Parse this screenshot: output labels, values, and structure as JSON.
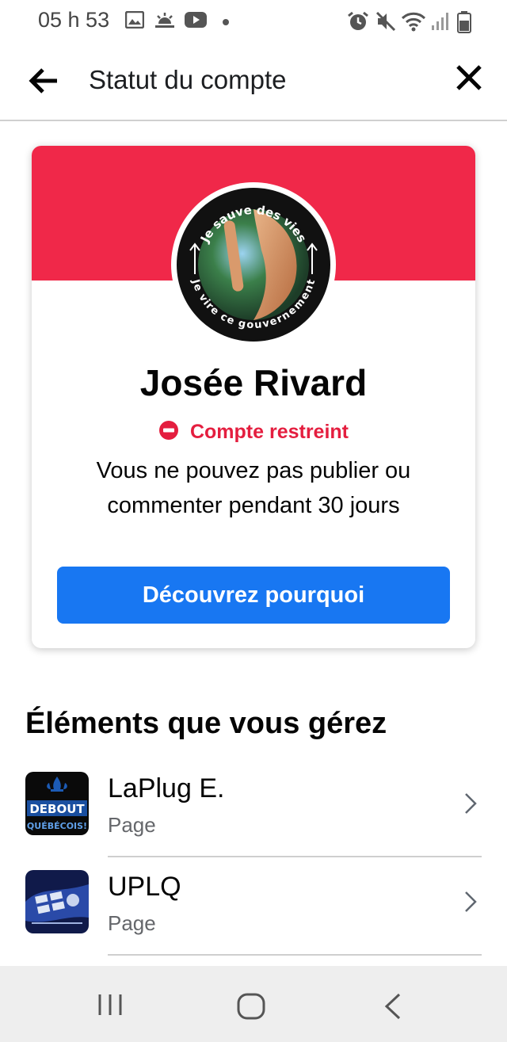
{
  "status_bar": {
    "time": "05 h 53",
    "icons": [
      "image-icon",
      "sunrise-icon",
      "youtube-icon",
      "dot-icon",
      "alarm-icon",
      "mute-icon",
      "wifi-icon",
      "signal-icon",
      "battery-icon"
    ]
  },
  "header": {
    "title": "Statut du compte",
    "back_icon": "back-arrow-icon",
    "close_icon": "close-icon"
  },
  "profile": {
    "name": "Josée Rivard",
    "avatar_text_top": "Je sauve des vies",
    "avatar_text_bottom": "Je vire ce gouvernement",
    "status_label": "Compte restreint",
    "status_icon": "restricted-icon",
    "message": "Vous ne pouvez pas publier ou commenter pendant 30 jours",
    "cta_label": "Découvrez pourquoi"
  },
  "managed": {
    "title": "Éléments que vous gérez",
    "items": [
      {
        "name": "LaPlug E.",
        "type": "Page",
        "thumb_text_1": "DEBOUT",
        "thumb_text_2": "QUÉBÉCOIS!"
      },
      {
        "name": "UPLQ",
        "type": "Page"
      }
    ]
  },
  "nav": {
    "buttons": [
      "recents-icon",
      "home-icon",
      "nav-back-icon"
    ]
  },
  "colors": {
    "banner": "#f02849",
    "accent": "#1877f2",
    "restricted": "#e41e3f",
    "secondary_text": "#65676b"
  }
}
